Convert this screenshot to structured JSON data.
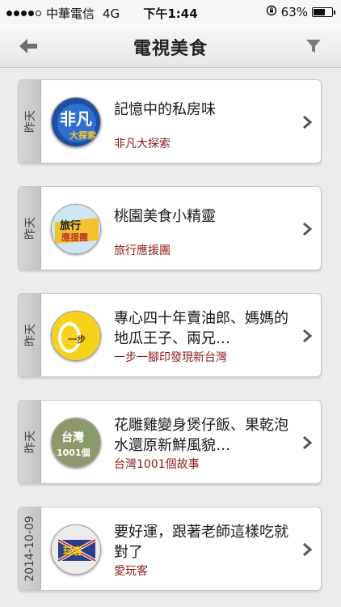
{
  "status_bar": {
    "carrier": "中華電信",
    "network": "4G",
    "time": "下午1:44",
    "battery": "63%",
    "battery_level": 0.63,
    "signal_bars": 4
  },
  "nav": {
    "title": "電視美食"
  },
  "items": [
    {
      "date": "昨天",
      "title": "記憶中的私房味",
      "show": "非凡大探索",
      "logo_text": "非凡大探索",
      "logo_color": "#1f4e9e"
    },
    {
      "date": "昨天",
      "title": "桃園美食小精靈",
      "show": "旅行應援團",
      "logo_text": "旅行應援團",
      "logo_color": "#f2c12e"
    },
    {
      "date": "昨天",
      "title": "專心四十年賣油郎、媽媽的地瓜王子、兩兄…",
      "show": "一步一腳印發現新台灣",
      "logo_text": "一步一腳印",
      "logo_color": "#f6d21a"
    },
    {
      "date": "昨天",
      "title": "花雕雞變身煲仔飯、果乾泡水還原新鮮風貌…",
      "show": "台灣1001個故事",
      "logo_text": "台灣1001個故事",
      "logo_color": "#8a9a6a"
    },
    {
      "date": "2014-10-09",
      "title": "要好運，跟著老師這樣吃就對了",
      "show": "愛玩客",
      "logo_text": "愛玩客",
      "logo_color": "#c0392b"
    }
  ],
  "colors": {
    "accent": "#8b1a1a",
    "nav_bg": "#f0f0f0",
    "page_bg": "#ececec"
  },
  "icons": {
    "back": "back-arrow-icon",
    "filter": "filter-funnel-icon",
    "chevron": "chevron-right-icon"
  }
}
